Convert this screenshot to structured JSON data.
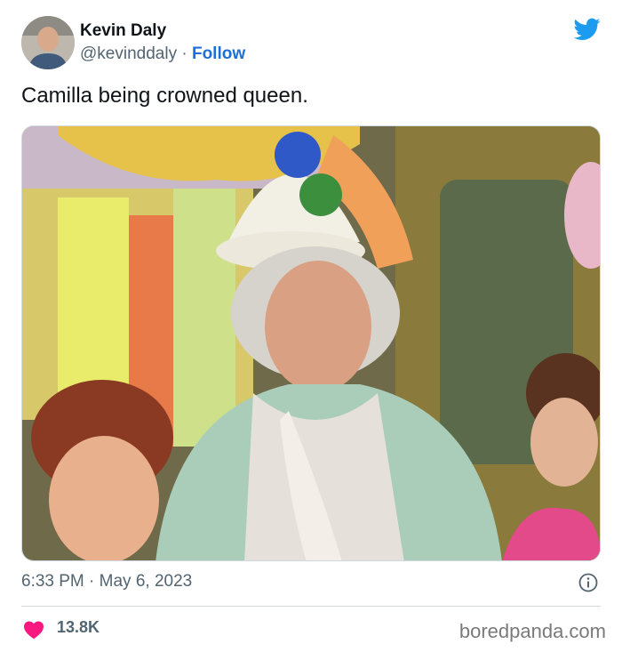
{
  "author": {
    "name": "Kevin Daly",
    "handle": "@kevinddaly",
    "separator": "·",
    "follow_label": "Follow"
  },
  "tweet": {
    "text": "Camilla being crowned queen.",
    "timestamp": "6:33 PM · May 6, 2023",
    "likes": "13.8K"
  },
  "watermark": "boredpanda.com",
  "colors": {
    "follow": "#1d6fd6",
    "twitter_blue": "#1d9bf0",
    "heart": "#f91880",
    "muted": "#536471"
  },
  "icons": [
    "twitter-bird-icon",
    "info-icon",
    "heart-icon"
  ]
}
